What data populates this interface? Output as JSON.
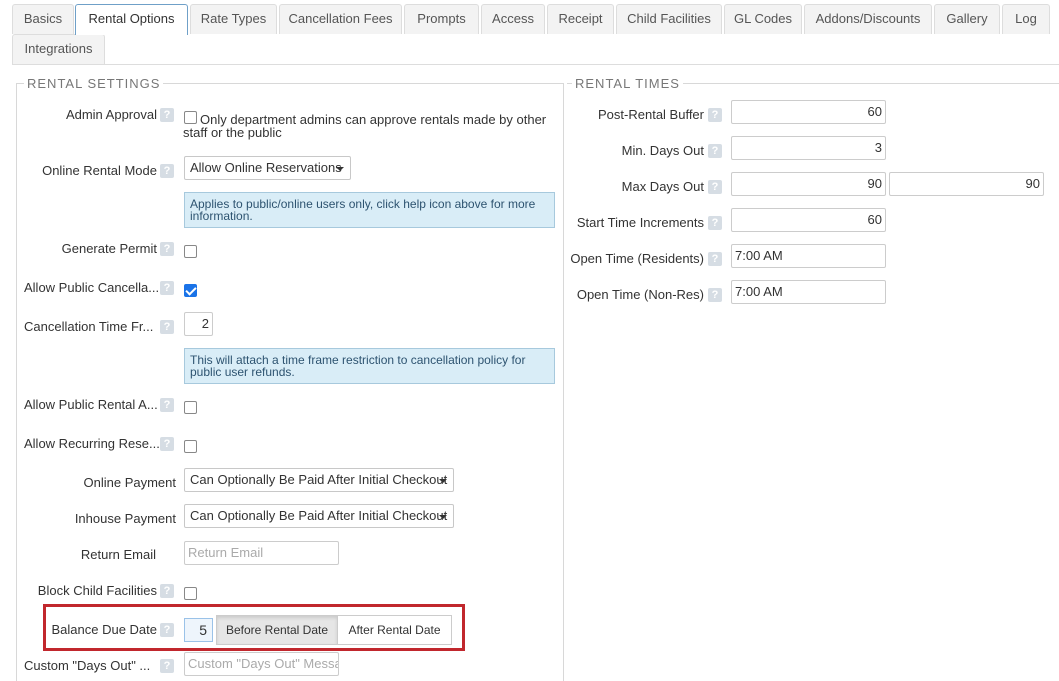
{
  "tabs": [
    {
      "label": "Basics",
      "active": false
    },
    {
      "label": "Rental Options",
      "active": true
    },
    {
      "label": "Rate Types",
      "active": false
    },
    {
      "label": "Cancellation Fees",
      "active": false
    },
    {
      "label": "Prompts",
      "active": false
    },
    {
      "label": "Access",
      "active": false
    },
    {
      "label": "Receipt",
      "active": false
    },
    {
      "label": "Child Facilities",
      "active": false
    },
    {
      "label": "GL Codes",
      "active": false
    },
    {
      "label": "Addons/Discounts",
      "active": false
    },
    {
      "label": "Gallery",
      "active": false
    },
    {
      "label": "Log",
      "active": false
    },
    {
      "label": "Integrations",
      "active": false
    }
  ],
  "rental_settings": {
    "legend": "RENTAL SETTINGS",
    "admin_approval": {
      "label": "Admin Approval",
      "checked": false,
      "text": "Only department admins can approve rentals made by other staff or the public"
    },
    "online_rental_mode": {
      "label": "Online Rental Mode",
      "value": "Allow Online Reservations",
      "info": "Applies to public/online users only, click help icon above for more information."
    },
    "generate_permit": {
      "label": "Generate Permit",
      "checked": false
    },
    "allow_public_cancellation": {
      "label": "Allow Public Cancella...",
      "checked": true
    },
    "cancellation_time_frame": {
      "label": "Cancellation Time Fr...",
      "value": "2",
      "info": "This will attach a time frame restriction to cancellation policy for public user refunds."
    },
    "allow_public_rental": {
      "label": "Allow Public Rental A...",
      "checked": false
    },
    "allow_recurring": {
      "label": "Allow Recurring Rese...",
      "checked": false
    },
    "online_payment": {
      "label": "Online Payment",
      "value": "Can Optionally Be Paid After Initial Checkout"
    },
    "inhouse_payment": {
      "label": "Inhouse Payment",
      "value": "Can Optionally Be Paid After Initial Checkout"
    },
    "return_email": {
      "label": "Return Email",
      "placeholder": "Return Email"
    },
    "block_child_facilities": {
      "label": "Block Child Facilities",
      "checked": false
    },
    "balance_due_date": {
      "label": "Balance Due Date",
      "value": "5",
      "before_label": "Before Rental Date",
      "after_label": "After Rental Date",
      "selected": "before"
    },
    "custom_days_out": {
      "label": "Custom \"Days Out\" ...",
      "placeholder": "Custom \"Days Out\" Messa"
    }
  },
  "rental_times": {
    "legend": "RENTAL TIMES",
    "post_rental_buffer": {
      "label": "Post-Rental Buffer",
      "value": "60"
    },
    "min_days_out": {
      "label": "Min. Days Out",
      "value": "3"
    },
    "max_days_out": {
      "label": "Max Days Out",
      "value": "90",
      "value2": "90"
    },
    "start_time_increments": {
      "label": "Start Time Increments",
      "value": "60"
    },
    "open_time_residents": {
      "label": "Open Time (Residents)",
      "value": "7:00 AM"
    },
    "open_time_nonres": {
      "label": "Open Time (Non-Res)",
      "value": "7:00 AM"
    }
  },
  "colors": {
    "highlight": "#c1272d",
    "checkbox": "#1a73e8",
    "info_bg": "#d9edf7"
  }
}
